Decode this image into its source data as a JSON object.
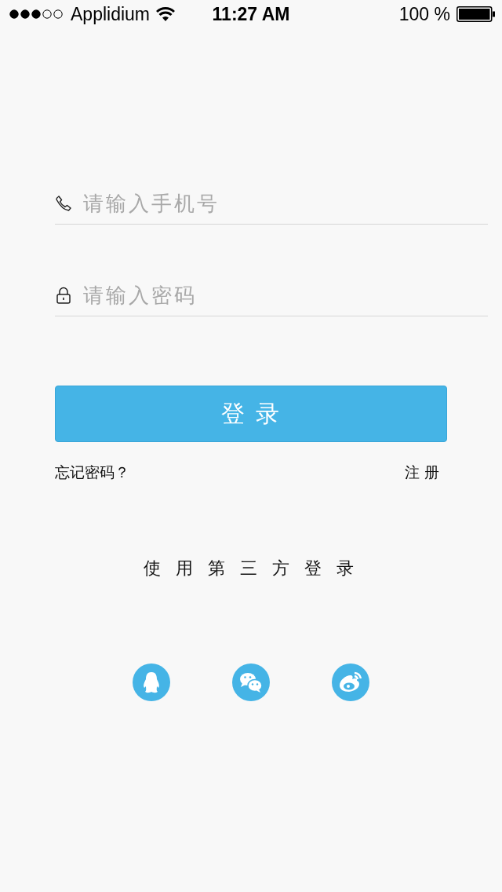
{
  "status_bar": {
    "carrier": "Applidium",
    "time": "11:27 AM",
    "battery": "100 %"
  },
  "fields": [
    {
      "kind": "phone",
      "placeholder": "请输入手机号"
    },
    {
      "kind": "password",
      "placeholder": "请输入密码"
    }
  ],
  "login_button": {
    "label": "登 录"
  },
  "links": {
    "forgot": "忘记密码？",
    "register": "注 册"
  },
  "third_party": {
    "title": "使 用 第 三 方 登 录",
    "providers": [
      {
        "kind": "penguin"
      },
      {
        "kind": "chat"
      },
      {
        "kind": "eye"
      }
    ]
  }
}
